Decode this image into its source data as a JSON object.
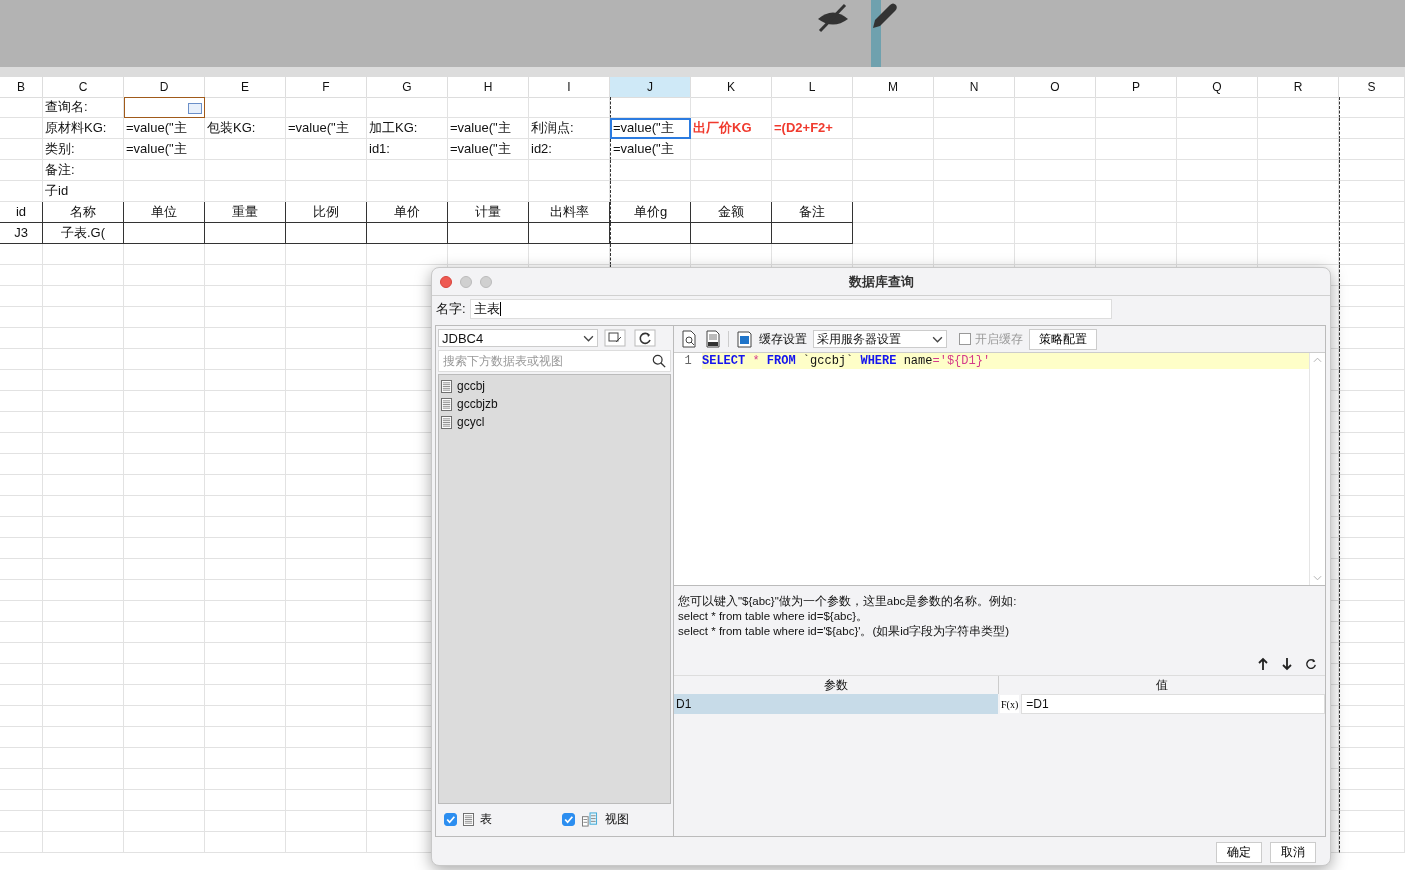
{
  "sheet": {
    "columns": [
      {
        "label": "B",
        "selected": false
      },
      {
        "label": "C",
        "selected": false
      },
      {
        "label": "D",
        "selected": false
      },
      {
        "label": "E",
        "selected": false
      },
      {
        "label": "F",
        "selected": false
      },
      {
        "label": "G",
        "selected": false
      },
      {
        "label": "H",
        "selected": false
      },
      {
        "label": "I",
        "selected": false
      },
      {
        "label": "J",
        "selected": true
      },
      {
        "label": "K",
        "selected": false
      },
      {
        "label": "L",
        "selected": false
      },
      {
        "label": "M",
        "selected": false
      },
      {
        "label": "N",
        "selected": false
      },
      {
        "label": "O",
        "selected": false
      },
      {
        "label": "P",
        "selected": false
      },
      {
        "label": "Q",
        "selected": false
      },
      {
        "label": "R",
        "selected": false
      },
      {
        "label": "S",
        "selected": false
      }
    ],
    "rows": [
      {
        "kind": "form",
        "cells": [
          "",
          "查询名:",
          {
            "kind": "combo"
          }
        ]
      },
      {
        "kind": "form",
        "cells": [
          "",
          "原材料KG:",
          "=value(\"主",
          "包装KG:",
          "=value(\"主",
          "加工KG:",
          "=value(\"主",
          "利润点:",
          {
            "text": "=value(\"主",
            "selected": true
          },
          {
            "text": "出厂价KG",
            "kind": "warn"
          },
          {
            "text": "=(D2+F2+",
            "kind": "warn"
          }
        ]
      },
      {
        "kind": "form",
        "cells": [
          "",
          "类别:",
          "=value(\"主",
          "",
          "",
          "id1:",
          "=value(\"主",
          "id2:",
          "=value(\"主"
        ]
      },
      {
        "kind": "form",
        "cells": [
          "",
          "备注:"
        ]
      },
      {
        "kind": "form",
        "cells": [
          "",
          "子id"
        ]
      },
      {
        "kind": "table",
        "cells": [
          "id",
          "名称",
          "单位",
          "重量",
          "比例",
          "单价",
          "计量",
          "出料率",
          "单价g",
          "金额",
          "备注"
        ]
      },
      {
        "kind": "table",
        "cells": [
          "J3",
          "子表.G("
        ]
      }
    ]
  },
  "dialog": {
    "title": "数据库查询",
    "name_label": "名字:",
    "name_value": "主表",
    "datasource": "JDBC4",
    "search": {
      "placeholder": "搜索下方数据表或视图"
    },
    "tables": [
      {
        "name": "gccbj",
        "selected": false
      },
      {
        "name": "gccbjzb",
        "selected": false
      },
      {
        "name": "gcycl",
        "selected": false
      }
    ],
    "filters": [
      {
        "label": "表",
        "checked": true,
        "kind": "table"
      },
      {
        "label": "视图",
        "checked": true,
        "kind": "view"
      }
    ],
    "cache_label": "缓存设置",
    "cache_option": "采用服务器设置",
    "enable_cache": {
      "label": "开启缓存",
      "checked": false,
      "disabled": true
    },
    "strategy_button": "策略配置",
    "sql": {
      "line_number": "1",
      "tokens": [
        {
          "text": "SELECT",
          "kind": "keyword"
        },
        {
          "text": " * ",
          "kind": "op"
        },
        {
          "text": "FROM",
          "kind": "keyword"
        },
        {
          "text": " `gccbj` ",
          "kind": "plain"
        },
        {
          "text": "WHERE",
          "kind": "keyword"
        },
        {
          "text": " name",
          "kind": "plain"
        },
        {
          "text": "=",
          "kind": "op"
        },
        {
          "text": "'${D1}'",
          "kind": "string"
        }
      ]
    },
    "help": [
      "您可以键入\"${abc}\"做为一个参数，这里abc是参数的名称。例如:",
      "select * from table where id=${abc}。",
      "select * from table where id='${abc}'。(如果id字段为字符串类型)"
    ],
    "params": {
      "columns": [
        "参数",
        "值"
      ],
      "rows": [
        {
          "name": "D1",
          "formula_button": "F(x)",
          "value": "=D1",
          "selected": true
        }
      ]
    },
    "buttons": [
      "确定",
      "取消"
    ]
  }
}
